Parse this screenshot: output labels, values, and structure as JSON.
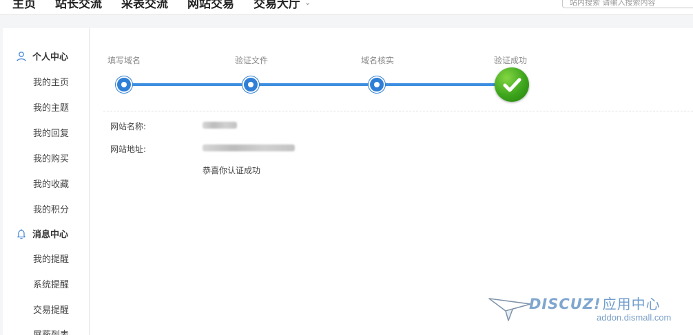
{
  "nav": {
    "items": [
      "主页",
      "站长交流",
      "采表交流",
      "网站交易",
      "交易大厅"
    ],
    "search_placeholder": "站内搜索 请输入搜索内容"
  },
  "sidebar": {
    "personal": {
      "title": "个人中心",
      "items": [
        "我的主页",
        "我的主题",
        "我的回复",
        "我的购买",
        "我的收藏",
        "我的积分"
      ]
    },
    "messages": {
      "title": "消息中心",
      "items": [
        "我的提醒",
        "系统提醒",
        "交易提醒",
        "屏蔽列表"
      ]
    }
  },
  "steps": [
    "填写域名",
    "验证文件",
    "域名核实",
    "验证成功"
  ],
  "result": {
    "name_label": "网站名称:",
    "url_label": "网站地址:",
    "success_message": "恭喜你认证成功"
  },
  "watermark": {
    "logo": "DISCUZ!",
    "suffix": "应用中心",
    "url": "addon.dismall.com"
  },
  "colors": {
    "accent": "#3d8ee0",
    "success": "#3da41c"
  }
}
